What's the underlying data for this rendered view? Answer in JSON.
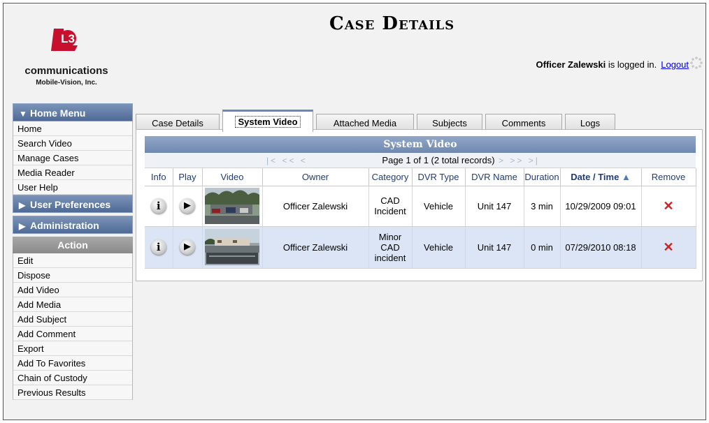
{
  "header": {
    "title": "Case Details",
    "logo_mark": "L3",
    "logo_text": "communications",
    "logo_sub": "Mobile-Vision, Inc.",
    "user_name": "Officer Zalewski",
    "login_suffix": " is logged in.",
    "logout_label": "Logout"
  },
  "sidebar": {
    "home_menu_label": "Home Menu",
    "home_items": [
      "Home",
      "Search Video",
      "Manage Cases",
      "Media Reader",
      "User Help"
    ],
    "user_prefs_label": "User Preferences",
    "admin_label": "Administration",
    "action_label": "Action",
    "action_items": [
      "Edit",
      "Dispose",
      "Add Video",
      "Add Media",
      "Add Subject",
      "Add Comment",
      "Export",
      "Add To Favorites",
      "Chain of Custody",
      "Previous Results"
    ]
  },
  "tabs": [
    "Case Details",
    "System Video",
    "Attached Media",
    "Subjects",
    "Comments",
    "Logs"
  ],
  "active_tab": "System Video",
  "grid": {
    "title": "System Video",
    "pager_text": "Page 1 of 1 (2 total records)",
    "columns": [
      "Info",
      "Play",
      "Video",
      "Owner",
      "Category",
      "DVR Type",
      "DVR Name",
      "Duration",
      "Date / Time",
      "Remove"
    ],
    "sort_indicator": "▲",
    "rows": [
      {
        "owner": "Officer Zalewski",
        "category": "CAD Incident",
        "dvr_type": "Vehicle",
        "dvr_name": "Unit 147",
        "duration": "3 min",
        "datetime": "10/29/2009 09:01"
      },
      {
        "owner": "Officer Zalewski",
        "category": "Minor CAD incident",
        "dvr_type": "Vehicle",
        "dvr_name": "Unit 147",
        "duration": "0 min",
        "datetime": "07/29/2010 08:18"
      }
    ],
    "info_glyph": "i",
    "play_glyph": "▶",
    "remove_glyph": "✕"
  },
  "colors": {
    "menu_header": "#5b76a3",
    "grid_header": "#7f97bb",
    "selected_row": "#dce5f5",
    "remove": "#cc2222"
  }
}
